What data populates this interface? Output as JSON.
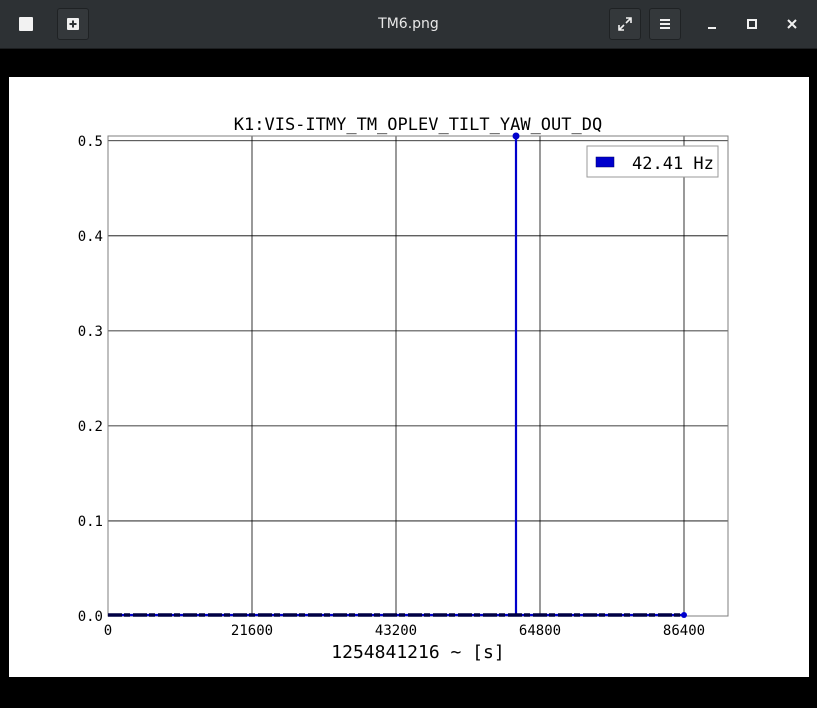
{
  "window": {
    "title": "TM6.png",
    "icons": {
      "left1": "image-icon",
      "left2": "add-icon",
      "fullscreen": "fullscreen-icon",
      "menu": "menu-icon",
      "minimize": "minimize-icon",
      "maximize": "maximize-icon",
      "close": "close-icon"
    }
  },
  "chart_data": {
    "type": "line",
    "title": "K1:VIS-ITMY_TM_OPLEV_TILT_YAW_OUT_DQ",
    "xlabel": "1254841216 ~ [s]",
    "ylabel": "",
    "xlim": [
      0,
      93000
    ],
    "ylim": [
      0,
      0.505
    ],
    "xticks": [
      0,
      21600,
      43200,
      64800,
      86400
    ],
    "xtick_labels": [
      "0",
      "21600",
      "43200",
      "64800",
      "86400"
    ],
    "yticks": [
      0.0,
      0.1,
      0.2,
      0.3,
      0.4,
      0.5
    ],
    "ytick_labels": [
      "0.0",
      "0.1",
      "0.2",
      "0.3",
      "0.4",
      "0.5"
    ],
    "grid": true,
    "legend_position": "top-right",
    "series": [
      {
        "name": "42.41 Hz",
        "color": "#0000cc",
        "x": [
          0,
          60000,
          61200,
          61200,
          61200,
          61300,
          86400
        ],
        "y": [
          0.001,
          0.001,
          0.001,
          0.505,
          0.001,
          0.001,
          0.001
        ]
      }
    ]
  }
}
